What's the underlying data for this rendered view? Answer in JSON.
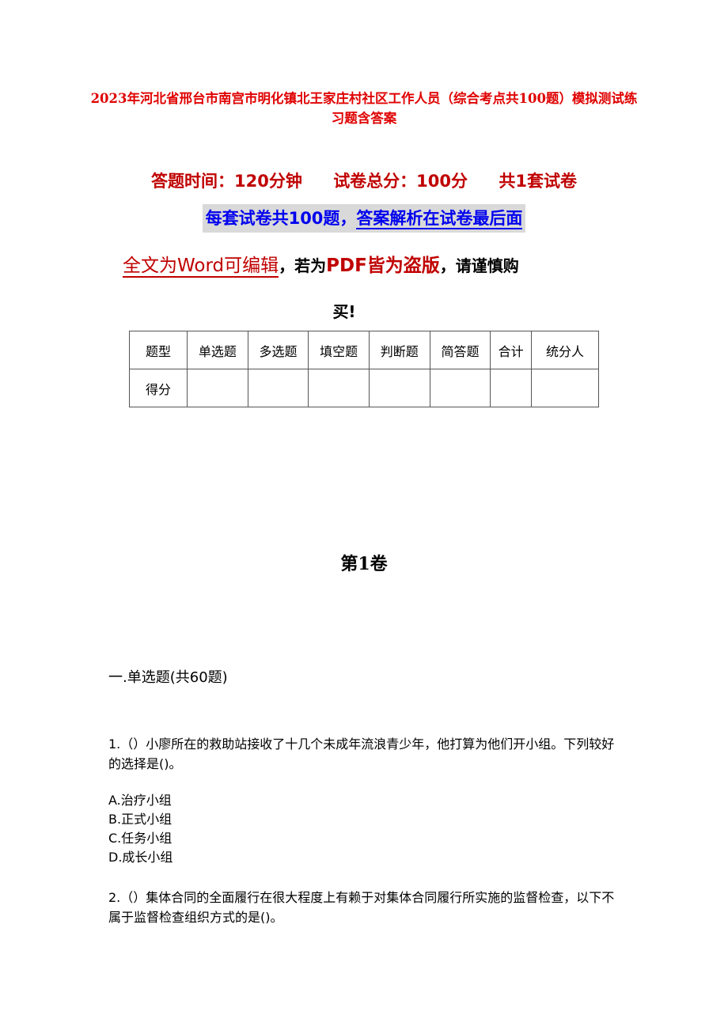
{
  "document": {
    "title": "2023年河北省邢台市南宫市明化镇北王家庄村社区工作人员（综合考点共100题）模拟测试练习题含答案",
    "info": {
      "time": "答题时间：120分钟",
      "total": "试卷总分：100分",
      "sets": "共1套试卷"
    },
    "notice_a": "每套试卷共100题，",
    "notice_b": "答案解析在试卷最后面",
    "edit_word": "全文为Word可编辑",
    "edit_comma1": "，若为",
    "edit_pdf": "PDF皆为盗版",
    "edit_tail": "，请谨慎购",
    "edit_last": "买!",
    "score_table": {
      "headers": [
        "题型",
        "单选题",
        "多选题",
        "填空题",
        "判断题",
        "简答题",
        "合计",
        "统分人"
      ],
      "row_label": "得分",
      "row_values": [
        "",
        "",
        "",
        "",
        "",
        "",
        ""
      ]
    },
    "volume": "第1卷",
    "section": "一.单选题(共60题)",
    "questions": [
      {
        "text": "1.（）小廖所在的救助站接收了十几个未成年流浪青少年，他打算为他们开小组。下列较好的选择是()。",
        "options": [
          "A.治疗小组",
          "B.正式小组",
          "C.任务小组",
          "D.成长小组"
        ]
      },
      {
        "text": "2.（）集体合同的全面履行在很大程度上有赖于对集体合同履行所实施的监督检查，以下不属于监督检查组织方式的是()。"
      }
    ]
  }
}
